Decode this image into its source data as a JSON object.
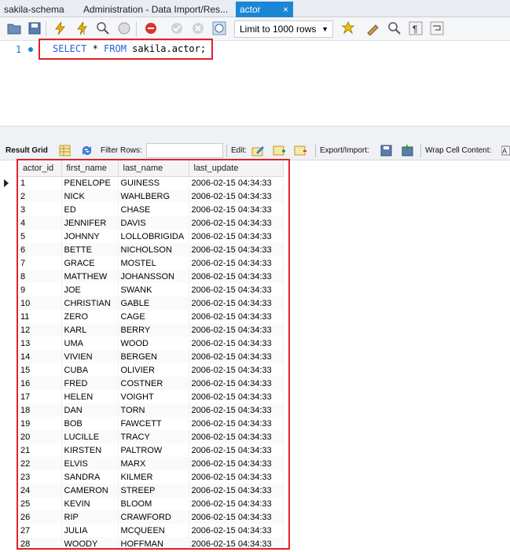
{
  "tabs": [
    {
      "label": "sakila-schema"
    },
    {
      "label": "Administration - Data Import/Res..."
    },
    {
      "label": "actor",
      "close": "×"
    }
  ],
  "toolbar": {
    "limit_label": "Limit to 1000 rows"
  },
  "editor": {
    "line_number": "1",
    "sql_kw1": "SELECT",
    "sql_mid": " * ",
    "sql_kw2": "FROM",
    "sql_rest": " sakila.actor;"
  },
  "result_toolbar": {
    "result_grid": "Result Grid",
    "filter_rows": "Filter Rows:",
    "edit": "Edit:",
    "export_import": "Export/Import:",
    "wrap": "Wrap Cell Content:"
  },
  "grid": {
    "columns": [
      "actor_id",
      "first_name",
      "last_name",
      "last_update"
    ],
    "rows": [
      [
        "1",
        "PENELOPE",
        "GUINESS",
        "2006-02-15 04:34:33"
      ],
      [
        "2",
        "NICK",
        "WAHLBERG",
        "2006-02-15 04:34:33"
      ],
      [
        "3",
        "ED",
        "CHASE",
        "2006-02-15 04:34:33"
      ],
      [
        "4",
        "JENNIFER",
        "DAVIS",
        "2006-02-15 04:34:33"
      ],
      [
        "5",
        "JOHNNY",
        "LOLLOBRIGIDA",
        "2006-02-15 04:34:33"
      ],
      [
        "6",
        "BETTE",
        "NICHOLSON",
        "2006-02-15 04:34:33"
      ],
      [
        "7",
        "GRACE",
        "MOSTEL",
        "2006-02-15 04:34:33"
      ],
      [
        "8",
        "MATTHEW",
        "JOHANSSON",
        "2006-02-15 04:34:33"
      ],
      [
        "9",
        "JOE",
        "SWANK",
        "2006-02-15 04:34:33"
      ],
      [
        "10",
        "CHRISTIAN",
        "GABLE",
        "2006-02-15 04:34:33"
      ],
      [
        "11",
        "ZERO",
        "CAGE",
        "2006-02-15 04:34:33"
      ],
      [
        "12",
        "KARL",
        "BERRY",
        "2006-02-15 04:34:33"
      ],
      [
        "13",
        "UMA",
        "WOOD",
        "2006-02-15 04:34:33"
      ],
      [
        "14",
        "VIVIEN",
        "BERGEN",
        "2006-02-15 04:34:33"
      ],
      [
        "15",
        "CUBA",
        "OLIVIER",
        "2006-02-15 04:34:33"
      ],
      [
        "16",
        "FRED",
        "COSTNER",
        "2006-02-15 04:34:33"
      ],
      [
        "17",
        "HELEN",
        "VOIGHT",
        "2006-02-15 04:34:33"
      ],
      [
        "18",
        "DAN",
        "TORN",
        "2006-02-15 04:34:33"
      ],
      [
        "19",
        "BOB",
        "FAWCETT",
        "2006-02-15 04:34:33"
      ],
      [
        "20",
        "LUCILLE",
        "TRACY",
        "2006-02-15 04:34:33"
      ],
      [
        "21",
        "KIRSTEN",
        "PALTROW",
        "2006-02-15 04:34:33"
      ],
      [
        "22",
        "ELVIS",
        "MARX",
        "2006-02-15 04:34:33"
      ],
      [
        "23",
        "SANDRA",
        "KILMER",
        "2006-02-15 04:34:33"
      ],
      [
        "24",
        "CAMERON",
        "STREEP",
        "2006-02-15 04:34:33"
      ],
      [
        "25",
        "KEVIN",
        "BLOOM",
        "2006-02-15 04:34:33"
      ],
      [
        "26",
        "RIP",
        "CRAWFORD",
        "2006-02-15 04:34:33"
      ],
      [
        "27",
        "JULIA",
        "MCQUEEN",
        "2006-02-15 04:34:33"
      ],
      [
        "28",
        "WOODY",
        "HOFFMAN",
        "2006-02-15 04:34:33"
      ]
    ]
  },
  "colors": {
    "highlight": "#e0222a",
    "active_tab": "#1a86d6",
    "sql_keyword": "#2a63d4"
  }
}
